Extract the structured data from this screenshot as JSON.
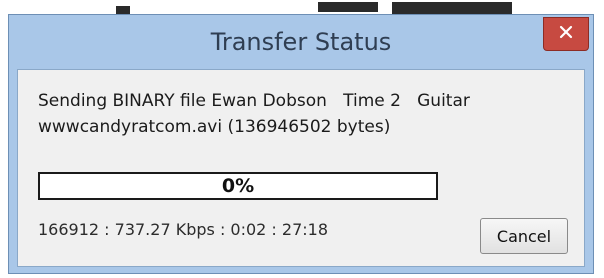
{
  "window": {
    "title": "Transfer Status",
    "close_icon": "close-icon"
  },
  "transfer": {
    "message_line1": "Sending BINARY file Ewan Dobson   Time 2   Guitar",
    "message_line2": "wwwcandyratcom.avi (136946502 bytes)",
    "progress_label": "0%",
    "progress_fraction": 0.0,
    "stats": "166912 : 737.27 Kbps : 0:02 : 27:18"
  },
  "buttons": {
    "cancel_label": "Cancel"
  },
  "colors": {
    "frame": "#a9c7e8",
    "close_button": "#c74a41",
    "client_bg": "#f0f0f0"
  }
}
